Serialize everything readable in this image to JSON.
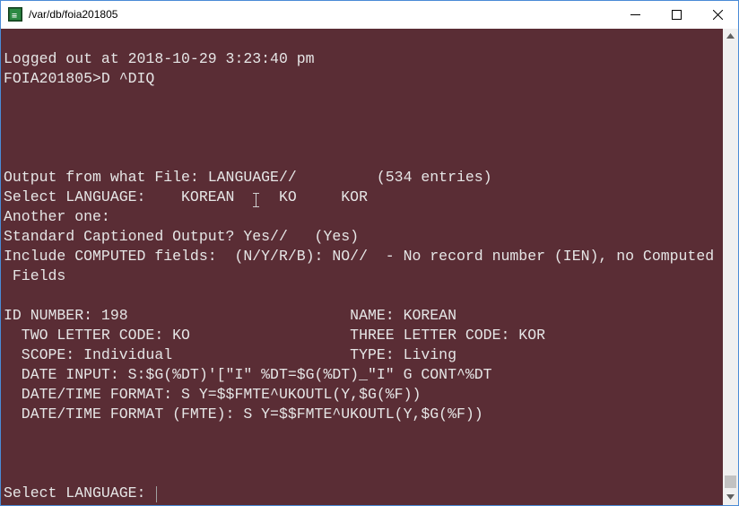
{
  "window": {
    "title": "/var/db/foia201805",
    "icon": "terminal-app-icon",
    "controls": {
      "minimize": "minimize-icon",
      "maximize": "maximize-icon",
      "close": "close-icon"
    }
  },
  "terminal": {
    "background": "#5a2d35",
    "foreground": "#e6e6e6",
    "lines": [
      "",
      "Logged out at 2018-10-29 3:23:40 pm",
      "FOIA201805>D ^DIQ",
      "",
      "",
      "",
      "",
      "Output from what File: LANGUAGE//         (534 entries)",
      "Select LANGUAGE:    KOREAN     KO     KOR",
      "Another one:",
      "Standard Captioned Output? Yes//   (Yes)",
      "Include COMPUTED fields:  (N/Y/R/B): NO//  - No record number (IEN), no Computed",
      " Fields",
      "",
      "ID NUMBER: 198                         NAME: KOREAN",
      "  TWO LETTER CODE: KO                  THREE LETTER CODE: KOR",
      "  SCOPE: Individual                    TYPE: Living",
      "  DATE INPUT: S:$G(%DT)'[\"I\" %DT=$G(%DT)_\"I\" G CONT^%DT",
      "  DATE/TIME FORMAT: S Y=$$FMTE^UKOUTL(Y,$G(%F))",
      "  DATE/TIME FORMAT (FMTE): S Y=$$FMTE^UKOUTL(Y,$G(%F))",
      "",
      "",
      "",
      "",
      "Select LANGUAGE: "
    ]
  },
  "scrollbar": {
    "up": "scroll-up-arrow-icon",
    "down": "scroll-down-arrow-icon"
  }
}
